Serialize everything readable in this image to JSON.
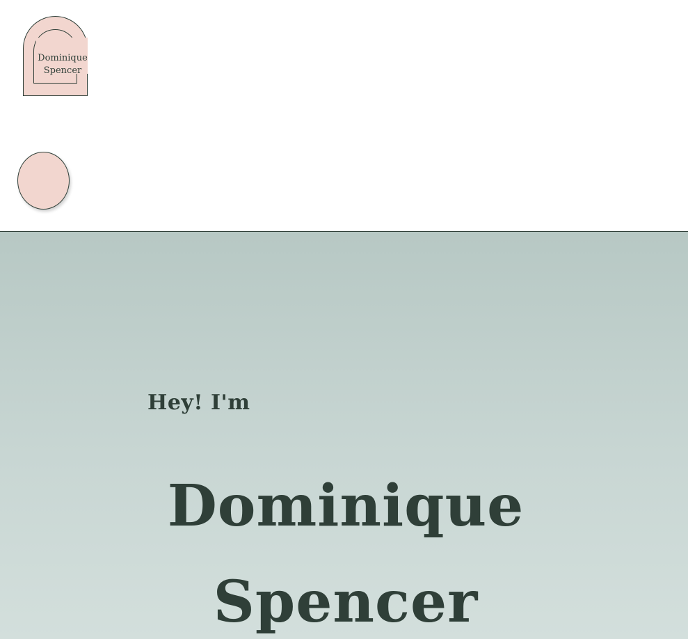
{
  "header": {
    "logo": {
      "line1": "Dominique",
      "line2": "Spencer"
    },
    "menu_toggle": {
      "label": ""
    }
  },
  "hero": {
    "greeting": "Hey! I'm",
    "name_line1": "Dominique",
    "name_line2": "Spencer"
  },
  "colors": {
    "accent_pink": "#f2d6cf",
    "ink_dark_green": "#2f3f38",
    "hero_background_top": "#b7c8c4",
    "hero_background_bottom": "#d3dfdc"
  }
}
